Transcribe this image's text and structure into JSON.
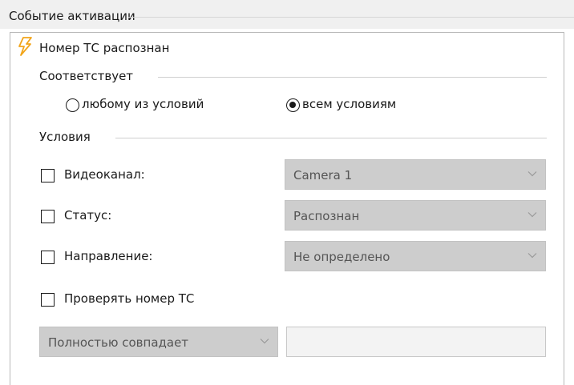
{
  "header": {
    "title": "Событие активации"
  },
  "event": {
    "label": "Номер ТС распознан",
    "icon": "lightning-icon",
    "icon_color": "#f2a51a"
  },
  "match": {
    "label": "Соответствует",
    "options": [
      {
        "label": "любому из условий",
        "checked": false
      },
      {
        "label": "всем условиям",
        "checked": true
      }
    ]
  },
  "conditions": {
    "label": "Условия",
    "rows": [
      {
        "label": "Видеоканал:",
        "checked": false,
        "value": "Camera 1"
      },
      {
        "label": "Статус:",
        "checked": false,
        "value": "Распознан"
      },
      {
        "label": "Направление:",
        "checked": false,
        "value": "Не определено"
      }
    ],
    "plate_check": {
      "label": "Проверять номер ТС",
      "checked": false
    },
    "match_mode": {
      "value": "Полностью совпадает"
    },
    "plate_input": {
      "value": ""
    }
  }
}
